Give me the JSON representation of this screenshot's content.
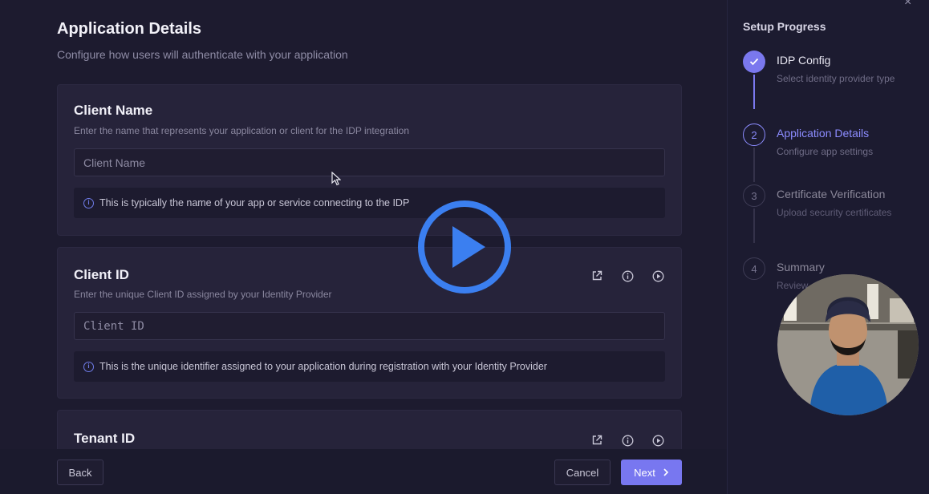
{
  "header": {
    "title": "Application Details",
    "subtitle": "Configure how users will authenticate with your application"
  },
  "cards": {
    "client_name": {
      "title": "Client Name",
      "description": "Enter the name that represents your application or client for the IDP integration",
      "placeholder": "Client Name",
      "hint": "This is typically the name of your app or service connecting to the IDP"
    },
    "client_id": {
      "title": "Client ID",
      "description": "Enter the unique Client ID assigned by your Identity Provider",
      "placeholder": "Client ID",
      "hint": "This is the unique identifier assigned to your application during registration with your Identity Provider"
    },
    "tenant_id": {
      "title": "Tenant ID"
    }
  },
  "footer": {
    "back_label": "Back",
    "cancel_label": "Cancel",
    "next_label": "Next"
  },
  "sidebar": {
    "title": "Setup Progress",
    "steps": [
      {
        "number": "1",
        "label": "IDP Config",
        "description": "Select identity provider type",
        "state": "complete"
      },
      {
        "number": "2",
        "label": "Application Details",
        "description": "Configure app settings",
        "state": "active"
      },
      {
        "number": "3",
        "label": "Certificate Verification",
        "description": "Upload security certificates",
        "state": "pending"
      },
      {
        "number": "4",
        "label": "Summary",
        "description": "Review",
        "state": "pending"
      }
    ]
  },
  "colors": {
    "accent": "#7877f0",
    "active_step": "#8c8cff",
    "play_button": "#3b7ff0"
  },
  "icons": [
    "info-icon",
    "external-link-icon",
    "play-circle-icon",
    "check-icon",
    "chevron-right-icon",
    "close-icon",
    "play-icon"
  ]
}
